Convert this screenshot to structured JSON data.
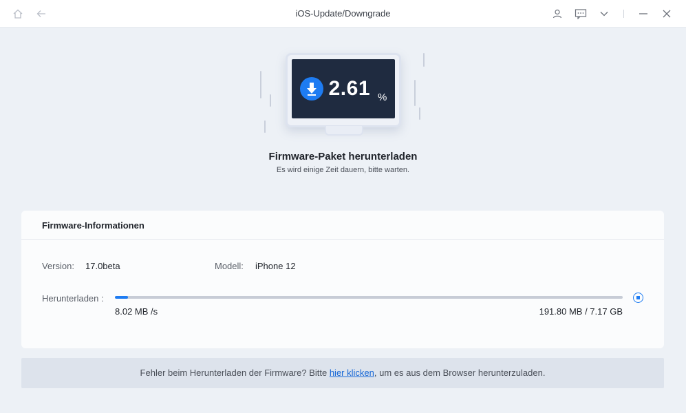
{
  "window": {
    "title": "iOS-Update/Downgrade",
    "icons": {
      "home": "home-icon",
      "back": "back-arrow-icon",
      "account": "user-icon",
      "feedback": "message-icon",
      "menu": "chevron-down-icon",
      "minimize": "minimize-icon",
      "close": "close-icon"
    }
  },
  "status": {
    "percent": "2.61",
    "percent_sign": "%",
    "title": "Firmware-Paket herunterladen",
    "subtitle": "Es wird einige Zeit dauern, bitte warten."
  },
  "firmware_info": {
    "title": "Firmware-Informationen",
    "version_label": "Version:",
    "version_value": "17.0beta",
    "model_label": "Modell:",
    "model_value": "iPhone 12",
    "download_label": "Herunterladen :",
    "progress_fraction": 0.0261,
    "speed": "8.02 MB /s",
    "size": "191.80 MB / 7.17 GB"
  },
  "help": {
    "prefix": "Fehler beim Herunterladen der Firmware? Bitte ",
    "link_text": "hier klicken",
    "suffix": ", um es aus dem Browser herunterzuladen."
  },
  "colors": {
    "accent": "#1e7cf2",
    "screen": "#1f2b40",
    "background": "#edf1f6"
  }
}
